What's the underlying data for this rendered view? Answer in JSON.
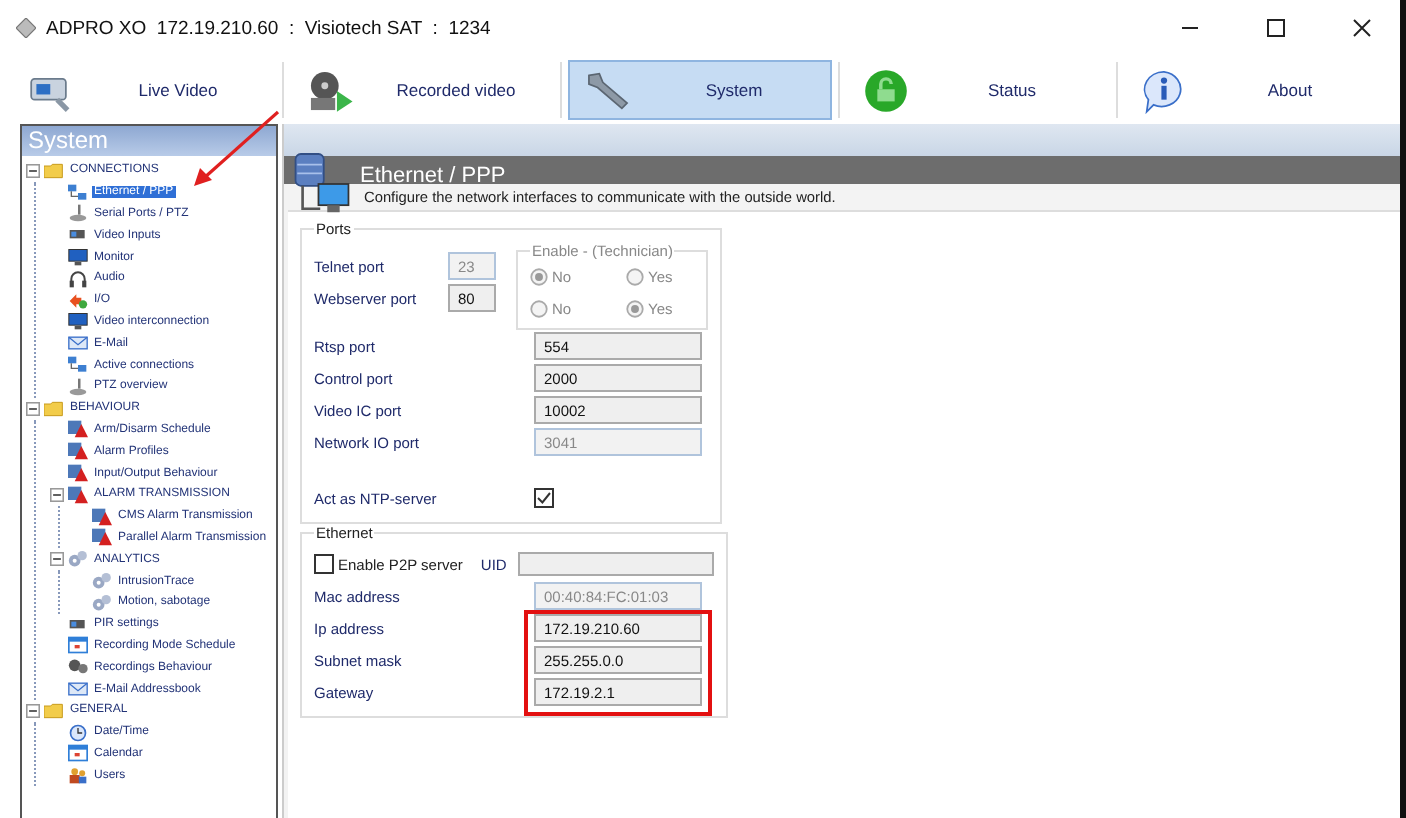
{
  "window": {
    "title": "ADPRO XO  172.19.210.60  :  Visiotech SAT  :  1234"
  },
  "nav": [
    {
      "label": "Live Video",
      "kind": "camera",
      "selected": false
    },
    {
      "label": "Recorded video",
      "kind": "film",
      "selected": false
    },
    {
      "label": "System",
      "kind": "wrench",
      "selected": true
    },
    {
      "label": "Status",
      "kind": "lock",
      "selected": false
    },
    {
      "label": "About",
      "kind": "info",
      "selected": false
    }
  ],
  "sidebar": {
    "title": "System",
    "tree": [
      {
        "label": "CONNECTIONS",
        "kind": "folder",
        "expanded": true,
        "selected": false,
        "children": [
          {
            "label": "Ethernet / PPP",
            "kind": "network",
            "selected": true
          },
          {
            "label": "Serial Ports / PTZ",
            "kind": "joystick",
            "selected": false
          },
          {
            "label": "Video Inputs",
            "kind": "camera",
            "selected": false
          },
          {
            "label": "Monitor",
            "kind": "monitor",
            "selected": false
          },
          {
            "label": "Audio",
            "kind": "headset",
            "selected": false
          },
          {
            "label": "I/O",
            "kind": "io",
            "selected": false
          },
          {
            "label": "Video interconnection",
            "kind": "monitor",
            "selected": false
          },
          {
            "label": "E-Mail",
            "kind": "mail",
            "selected": false
          },
          {
            "label": "Active connections",
            "kind": "network",
            "selected": false
          },
          {
            "label": "PTZ overview",
            "kind": "joystick",
            "selected": false
          }
        ]
      },
      {
        "label": "BEHAVIOUR",
        "kind": "folder",
        "expanded": true,
        "selected": false,
        "children": [
          {
            "label": "Arm/Disarm Schedule",
            "kind": "alarm",
            "selected": false
          },
          {
            "label": "Alarm Profiles",
            "kind": "alarm",
            "selected": false
          },
          {
            "label": "Input/Output Behaviour",
            "kind": "alarm",
            "selected": false
          },
          {
            "label": "ALARM TRANSMISSION",
            "kind": "alarm",
            "expanded": true,
            "selected": false,
            "children": [
              {
                "label": "CMS Alarm Transmission",
                "kind": "alarm",
                "selected": false
              },
              {
                "label": "Parallel Alarm Transmission",
                "kind": "alarm",
                "selected": false
              }
            ]
          },
          {
            "label": "ANALYTICS",
            "kind": "gears",
            "expanded": true,
            "selected": false,
            "children": [
              {
                "label": "IntrusionTrace",
                "kind": "gears",
                "selected": false
              },
              {
                "label": "Motion, sabotage",
                "kind": "gears",
                "selected": false
              }
            ]
          },
          {
            "label": "PIR settings",
            "kind": "camera",
            "selected": false
          },
          {
            "label": "Recording Mode Schedule",
            "kind": "calendar",
            "selected": false
          },
          {
            "label": "Recordings Behaviour",
            "kind": "film",
            "selected": false
          },
          {
            "label": "E-Mail Addressbook",
            "kind": "mail",
            "selected": false
          }
        ]
      },
      {
        "label": "GENERAL",
        "kind": "folder",
        "expanded": true,
        "selected": false,
        "children": [
          {
            "label": "Date/Time",
            "kind": "clock",
            "selected": false
          },
          {
            "label": "Calendar",
            "kind": "calendar",
            "selected": false
          },
          {
            "label": "Users",
            "kind": "users",
            "selected": false
          }
        ]
      }
    ]
  },
  "page": {
    "title": "Ethernet / PPP",
    "description": "Configure the network interfaces to communicate with the outside world.",
    "ports": {
      "legend": "Ports",
      "enable_legend": "Enable - (Technician)",
      "port_rows": [
        {
          "label": "Telnet port",
          "value": "23",
          "disabled": true,
          "options": [
            {
              "label": "No",
              "selected": true
            },
            {
              "label": "Yes",
              "selected": false
            }
          ]
        },
        {
          "label": "Webserver port",
          "value": "80",
          "disabled": false,
          "options": [
            {
              "label": "No",
              "selected": false
            },
            {
              "label": "Yes",
              "selected": true
            }
          ]
        }
      ],
      "fields": [
        {
          "label": "Rtsp port",
          "value": "554",
          "disabled": false
        },
        {
          "label": "Control port",
          "value": "2000",
          "disabled": false
        },
        {
          "label": "Video IC port",
          "value": "10002",
          "disabled": false
        },
        {
          "label": "Network IO port",
          "value": "3041",
          "disabled": true
        }
      ],
      "ntp": {
        "label": "Act as NTP-server",
        "checked": true
      }
    },
    "ethernet": {
      "legend": "Ethernet",
      "p2p": {
        "label": "Enable P2P server",
        "checked": false
      },
      "uid_label": "UID",
      "fields": [
        {
          "label": "Mac address",
          "value": "00:40:84:FC:01:03",
          "disabled": true,
          "highlighted": false
        },
        {
          "label": "Ip address",
          "value": "172.19.210.60",
          "disabled": false,
          "highlighted": true
        },
        {
          "label": "Subnet mask",
          "value": "255.255.0.0",
          "disabled": false,
          "highlighted": true
        },
        {
          "label": "Gateway",
          "value": "172.19.2.1",
          "disabled": false,
          "highlighted": true
        }
      ]
    }
  }
}
